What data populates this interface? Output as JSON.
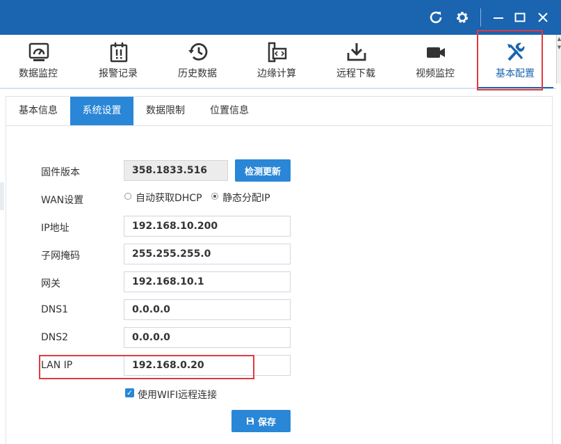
{
  "toolbar": {
    "items": [
      {
        "label": "数据监控",
        "icon": "dashboard-gauge-icon"
      },
      {
        "label": "报警记录",
        "icon": "alarm-record-icon"
      },
      {
        "label": "历史数据",
        "icon": "history-clock-icon"
      },
      {
        "label": "边缘计算",
        "icon": "edge-computing-icon"
      },
      {
        "label": "远程下载",
        "icon": "download-icon"
      },
      {
        "label": "视频监控",
        "icon": "video-camera-icon"
      },
      {
        "label": "基本配置",
        "icon": "wrench-screwdriver-icon"
      }
    ],
    "active_index": 6
  },
  "subtabs": [
    "基本信息",
    "系统设置",
    "数据限制",
    "位置信息"
  ],
  "form": {
    "firmware": {
      "label": "固件版本",
      "value": "358.1833.516",
      "button": "检测更新"
    },
    "wan": {
      "label": "WAN设置",
      "option_dhcp": "自动获取DHCP",
      "option_static": "静态分配IP",
      "selected": "static"
    },
    "ip": {
      "label": "IP地址",
      "value": "192.168.10.200"
    },
    "mask": {
      "label": "子网掩码",
      "value": "255.255.255.0"
    },
    "gateway": {
      "label": "网关",
      "value": "192.168.10.1"
    },
    "dns1": {
      "label": "DNS1",
      "value": "0.0.0.0"
    },
    "dns2": {
      "label": "DNS2",
      "value": "0.0.0.0"
    },
    "lan_ip": {
      "label": "LAN IP",
      "value": "192.168.0.20"
    },
    "wifi": {
      "label": "使用WIFI远程连接",
      "checked": true
    },
    "save_label": "保存"
  },
  "colors": {
    "title_bar": "#1a64b0",
    "accent": "#2a86d6",
    "highlight": "#e0393e"
  }
}
